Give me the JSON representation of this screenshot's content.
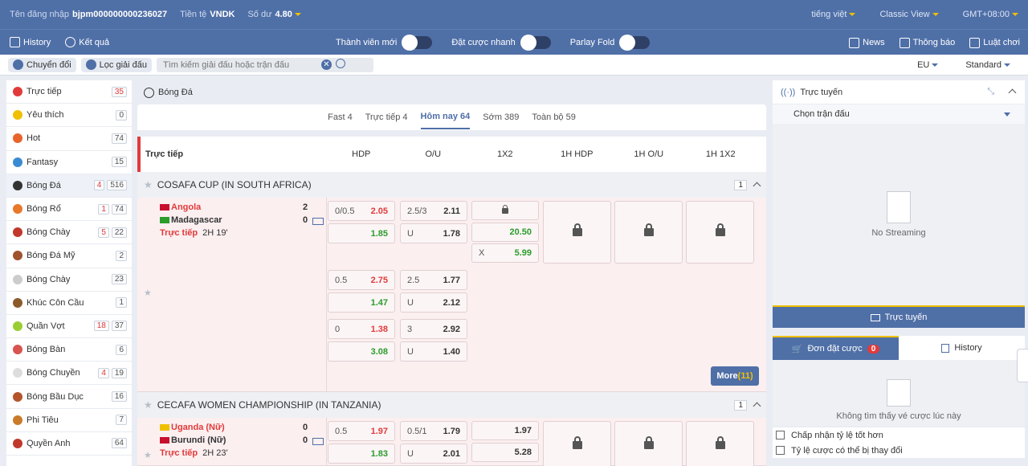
{
  "topbar": {
    "login_label": "Tên đăng nhập",
    "login_value": "bjpm000000000236027",
    "currency_label": "Tiền tệ",
    "currency_value": "VNDK",
    "balance_label": "Số dư",
    "balance_value": "4.80",
    "language": "tiếng việt",
    "view": "Classic View",
    "timezone": "GMT+08:00"
  },
  "nav": {
    "history": "History",
    "results": "Kết quả",
    "toggles": [
      "Thành viên mới",
      "Đặt cược nhanh",
      "Parlay Fold"
    ],
    "news": "News",
    "notice": "Thông báo",
    "rules": "Luật chơi"
  },
  "search": {
    "switch_label": "Chuyển đổi",
    "filter_label": "Lọc giải đấu",
    "placeholder": "Tìm kiếm giải đấu hoặc trận đấu",
    "close_glyph": "✕",
    "odds_type": "EU",
    "mode": "Standard"
  },
  "sidebar": {
    "items": [
      {
        "name": "Trực tiếp",
        "live": "",
        "count": "35",
        "color": "#e23a3a",
        "red": true
      },
      {
        "name": "Yêu thích",
        "live": "",
        "count": "0",
        "color": "#f0c000"
      },
      {
        "name": "Hot",
        "live": "",
        "count": "74",
        "color": "#e8642a"
      },
      {
        "name": "Fantasy",
        "live": "",
        "count": "15",
        "color": "#3a8bd1"
      },
      {
        "name": "Bóng Đá",
        "live": "4",
        "count": "516",
        "color": "#333333",
        "active": true
      },
      {
        "name": "Bóng Rổ",
        "live": "1",
        "count": "74",
        "color": "#e8782a"
      },
      {
        "name": "Bóng Chày",
        "live": "5",
        "count": "22",
        "color": "#c0392b"
      },
      {
        "name": "Bóng Đá Mỹ",
        "live": "",
        "count": "2",
        "color": "#a0522d"
      },
      {
        "name": "Bóng Chày",
        "live": "",
        "count": "23",
        "color": "#cccccc"
      },
      {
        "name": "Khúc Côn Cầu",
        "live": "",
        "count": "1",
        "color": "#8b5a2b"
      },
      {
        "name": "Quần Vợt",
        "live": "18",
        "count": "37",
        "color": "#9acd32"
      },
      {
        "name": "Bóng Bàn",
        "live": "",
        "count": "6",
        "color": "#d9534f"
      },
      {
        "name": "Bóng Chuyền",
        "live": "4",
        "count": "19",
        "color": "#dddddd"
      },
      {
        "name": "Bóng Bầu Dục",
        "live": "",
        "count": "16",
        "color": "#b5542a"
      },
      {
        "name": "Phi Tiêu",
        "live": "",
        "count": "7",
        "color": "#c97b2a"
      },
      {
        "name": "Quyền Anh",
        "live": "",
        "count": "64",
        "color": "#c0392b"
      }
    ]
  },
  "main": {
    "sport_title": "Bóng Đá",
    "tabs": [
      "Fast 4",
      "Trực tiếp 4",
      "Hôm nay 64",
      "Sớm 389",
      "Toàn bộ 59"
    ],
    "active_tab": 2,
    "columns": {
      "first": "Trực tiếp",
      "names": [
        "HDP",
        "O/U",
        "1X2",
        "1H HDP",
        "1H O/U",
        "1H 1X2"
      ]
    },
    "leagues": [
      {
        "name": "COSAFA CUP (IN SOUTH AFRICA)",
        "count": "1",
        "home": "Angola",
        "away": "Madagascar",
        "home_score": "2",
        "away_score": "0",
        "live_label": "Trực tiếp",
        "time": "2H 19'",
        "more_label": "More",
        "more_count": "(11)",
        "lines": [
          {
            "hdp": "0/0.5",
            "hdp_home": "2.05",
            "hdp_away": "1.85",
            "ou": "2.5/3",
            "ou_over": "2.11",
            "ou_u": "U",
            "ou_under": "1.78",
            "x12": [
              "",
              "20.50",
              "5.99"
            ],
            "x_label": "X"
          },
          {
            "hdp": "0.5",
            "hdp_home": "2.75",
            "hdp_away": "1.47",
            "ou": "2.5",
            "ou_over": "1.77",
            "ou_u": "U",
            "ou_under": "2.12"
          },
          {
            "hdp": "0",
            "hdp_home": "1.38",
            "hdp_away": "3.08",
            "ou": "3",
            "ou_over": "2.92",
            "ou_u": "U",
            "ou_under": "1.40"
          }
        ]
      },
      {
        "name": "CECAFA WOMEN CHAMPIONSHIP (IN TANZANIA)",
        "count": "1",
        "home": "Uganda (Nữ)",
        "away": "Burundi (Nữ)",
        "home_score": "0",
        "away_score": "0",
        "live_label": "Trực tiếp",
        "time": "2H 23'",
        "lines": [
          {
            "hdp": "0.5",
            "hdp_home": "1.97",
            "hdp_away": "1.83",
            "ou": "0.5/1",
            "ou_over": "1.79",
            "ou_u": "U",
            "ou_under": "2.01",
            "x12": [
              "1.97",
              "5.28"
            ]
          }
        ]
      }
    ]
  },
  "right": {
    "live_title": "Trực tuyến",
    "choose_match": "Chọn trận đấu",
    "no_streaming": "No Streaming",
    "live_button": "Trực tuyến",
    "bet_tab": "Đơn đặt cược",
    "bet_count": "0",
    "history_tab": "History",
    "no_bets": "Không tìm thấy vé cược lúc này",
    "options": [
      "Chấp nhận tỷ lệ tốt hơn",
      "Tỷ lệ cược có thể bị thay đổi"
    ]
  }
}
